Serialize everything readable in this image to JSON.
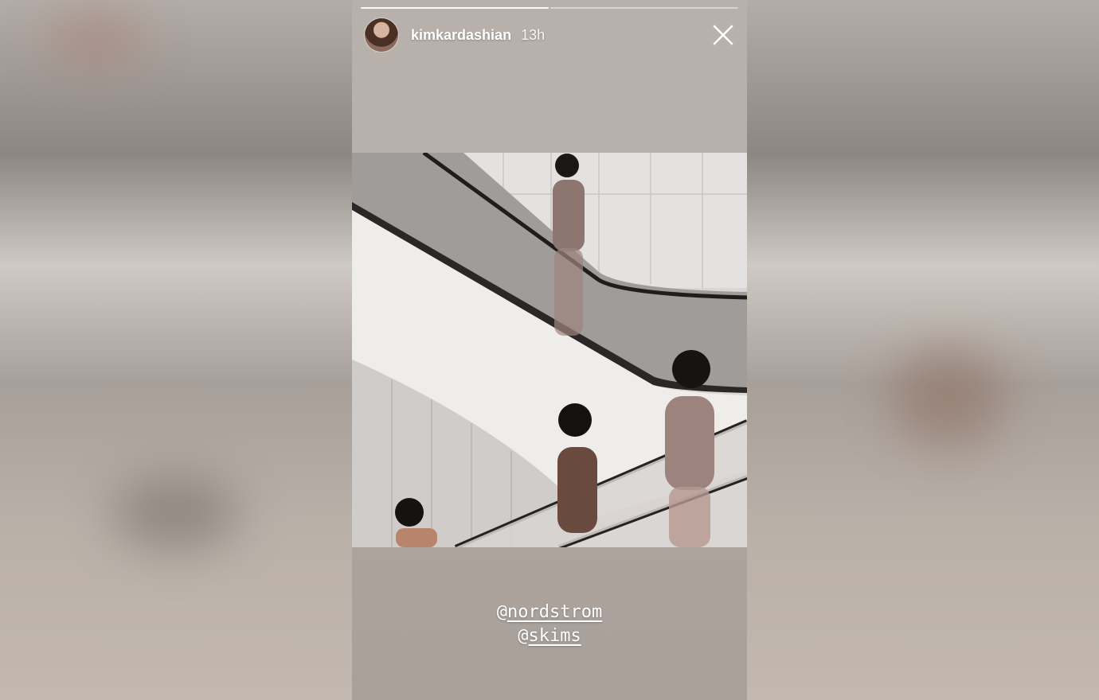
{
  "story": {
    "username": "kimkardashian",
    "time_ago": "13h",
    "progress": {
      "segments": 2,
      "completed": 1
    },
    "mentions": [
      {
        "at": "@",
        "handle": "nordstrom"
      },
      {
        "at": "@",
        "handle": "skims"
      }
    ],
    "icons": {
      "close": "close-icon",
      "avatar": "profile-avatar"
    }
  }
}
